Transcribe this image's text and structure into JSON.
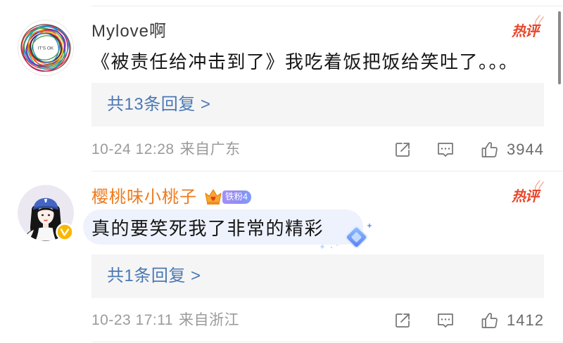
{
  "comments": [
    {
      "username": "Mylove啊",
      "avatar_icon": "scribble-avatar",
      "avatar_text": "IT'S OK",
      "hot_label": "热评",
      "text": "《被责任给冲击到了》我吃着饭把饭给笑吐了。。。",
      "reply_summary": "共13条回复 >",
      "timestamp": "10-24 12:28",
      "location": "来自广东",
      "like_count": "3944"
    },
    {
      "username": "樱桃味小桃子",
      "avatar_icon": "girl-cap-avatar",
      "badge_icon": "verified-icon",
      "fan_badge_icon": "crown-icon",
      "fan_badge": "铁粉4",
      "hot_label": "热评",
      "text": "真的要笑死我了非常的精彩",
      "decoration_icon": "diamond-icon",
      "reply_summary": "共1条回复 >",
      "timestamp": "10-23 17:11",
      "location": "来自浙江",
      "like_count": "1412"
    }
  ],
  "actions": {
    "icons": [
      "share-icon",
      "comment-icon",
      "like-icon"
    ]
  },
  "colors": {
    "link": "#4b78b3",
    "vip_name": "#ee7a1c",
    "hot": "#e8472b",
    "meta_text": "#9b9b9b",
    "like_count": "#6b6b6b",
    "icon_stroke": "#747474",
    "reply_bg": "#f5f5f5",
    "bubble_bg": "#eef2fc",
    "fan_badge": "#8f8cf2",
    "verified": "#f7b705"
  }
}
